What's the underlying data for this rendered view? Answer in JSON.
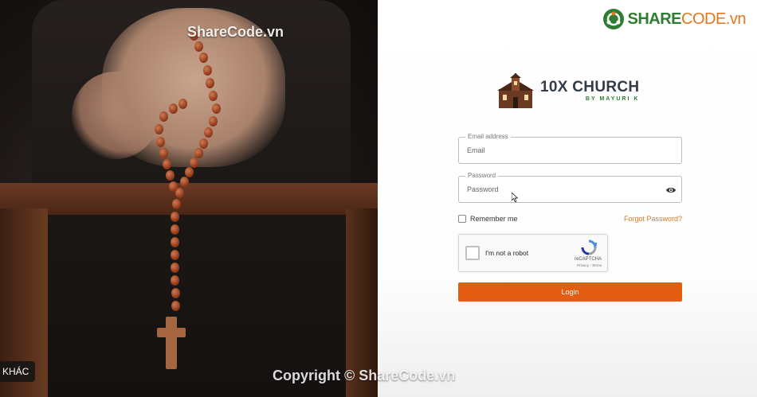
{
  "watermark": {
    "top": "ShareCode.vn",
    "bottom": "Copyright © ShareCode.vn",
    "logo_main": "SHARE",
    "logo_suffix": "CODE.vn"
  },
  "left_badge": "KHÁC",
  "brand": {
    "title": "10X CHURCH",
    "subtitle": "BY MAYURI K",
    "icon": "church-icon",
    "accent": "#2f7d32"
  },
  "form": {
    "email": {
      "legend": "Email address",
      "placeholder": "Email",
      "value": ""
    },
    "password": {
      "legend": "Password",
      "placeholder": "Password",
      "value": "",
      "toggle_icon": "eye-icon"
    },
    "remember_label": "Remember me",
    "remember_checked": false,
    "forgot_label": "Forgot Password?",
    "login_label": "Login",
    "login_color": "#e25d12",
    "link_color": "#e0761f"
  },
  "captcha": {
    "label": "I'm not a robot",
    "brand": "reCAPTCHA",
    "terms": "Privacy - Terms",
    "checked": false
  }
}
